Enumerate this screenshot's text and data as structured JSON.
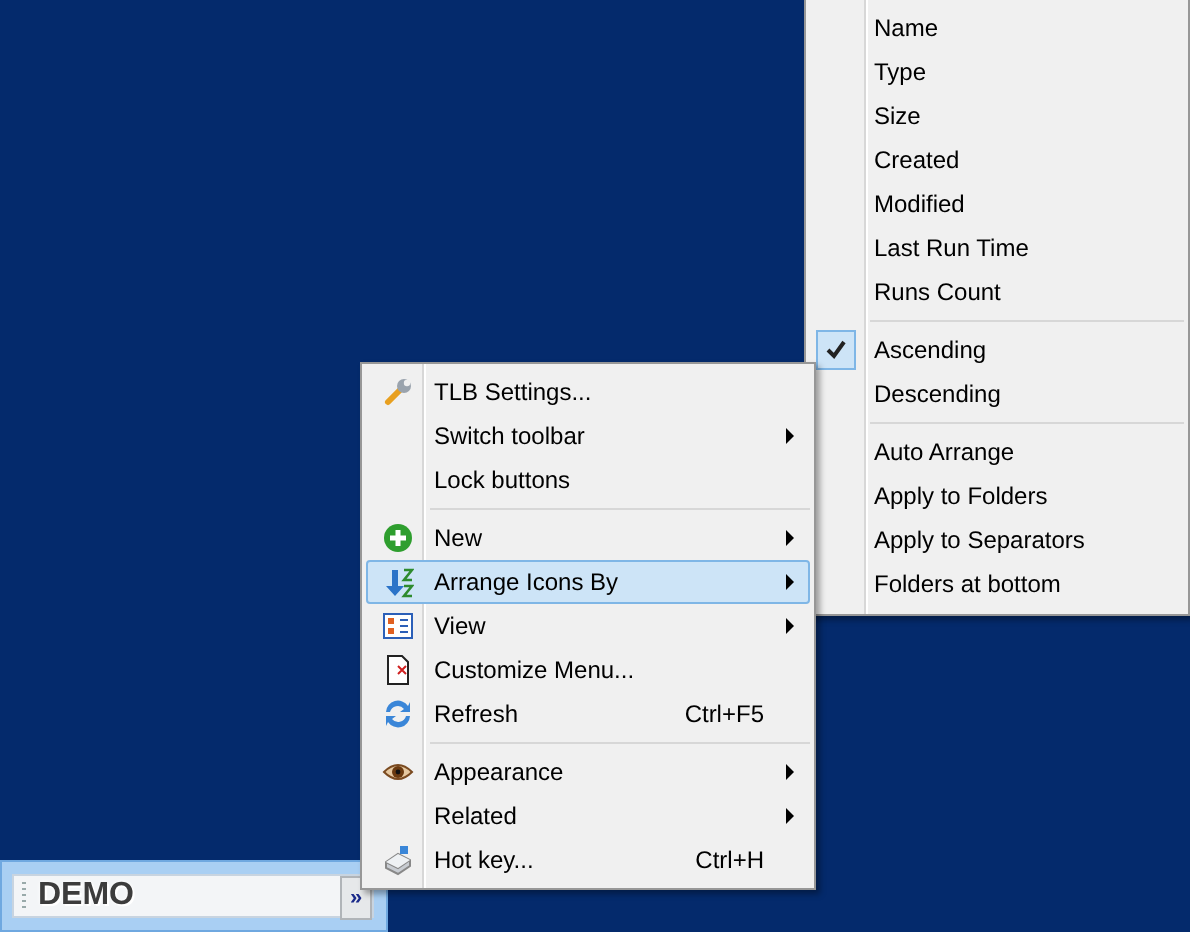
{
  "context_menu": {
    "groups": [
      {
        "items": [
          {
            "label": "TLB Settings...",
            "has_submenu": false,
            "selected": false
          },
          {
            "label": "Switch toolbar",
            "has_submenu": true,
            "selected": false
          },
          {
            "label": "Lock buttons",
            "has_submenu": false,
            "selected": false
          }
        ]
      },
      {
        "items": [
          {
            "label": "New",
            "has_submenu": true,
            "selected": false
          },
          {
            "label": "Arrange Icons By",
            "has_submenu": true,
            "selected": true
          },
          {
            "label": "View",
            "has_submenu": true,
            "selected": false
          },
          {
            "label": "Customize Menu...",
            "has_submenu": false,
            "selected": false
          },
          {
            "label": "Refresh",
            "shortcut": "Ctrl+F5",
            "has_submenu": false,
            "selected": false
          }
        ]
      },
      {
        "items": [
          {
            "label": "Appearance",
            "has_submenu": true,
            "selected": false
          },
          {
            "label": "Related",
            "has_submenu": true,
            "selected": false
          },
          {
            "label": "Hot key...",
            "shortcut": "Ctrl+H",
            "has_submenu": false,
            "selected": false
          }
        ]
      }
    ]
  },
  "arrange_submenu": {
    "groups": [
      {
        "items": [
          {
            "label": "Name",
            "checked": false
          },
          {
            "label": "Type",
            "checked": false
          },
          {
            "label": "Size",
            "checked": false
          },
          {
            "label": "Created",
            "checked": false
          },
          {
            "label": "Modified",
            "checked": false
          },
          {
            "label": "Last Run Time",
            "checked": false
          },
          {
            "label": "Runs Count",
            "checked": false
          }
        ]
      },
      {
        "items": [
          {
            "label": "Ascending",
            "checked": true
          },
          {
            "label": "Descending",
            "checked": false
          }
        ]
      },
      {
        "items": [
          {
            "label": "Auto Arrange",
            "checked": false
          },
          {
            "label": "Apply to Folders",
            "checked": false
          },
          {
            "label": "Apply to Separators",
            "checked": false
          },
          {
            "label": "Folders at bottom",
            "checked": false
          }
        ]
      }
    ]
  },
  "toolbar": {
    "label": "DEMO",
    "chevron": "»"
  }
}
